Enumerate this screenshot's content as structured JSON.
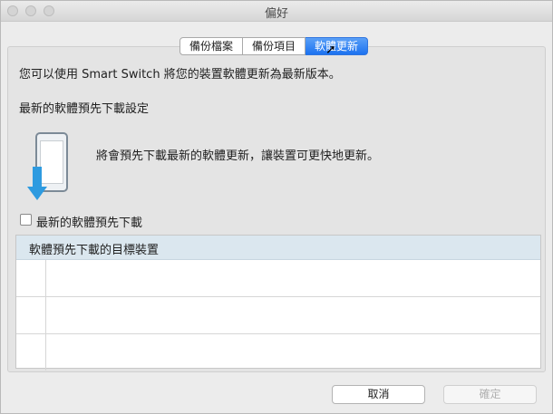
{
  "window": {
    "title": "偏好"
  },
  "tabs": [
    {
      "label": "備份檔案",
      "active": false
    },
    {
      "label": "備份項目",
      "active": false
    },
    {
      "label": "軟體更新",
      "active": true
    }
  ],
  "content": {
    "intro": "您可以使用 Smart Switch 將您的裝置軟體更新為最新版本。",
    "section_title": "最新的軟體預先下載設定",
    "description": "將會預先下載最新的軟體更新，讓裝置可更快地更新。",
    "checkbox_label": "最新的軟體預先下載",
    "checkbox_checked": false,
    "table_header": "軟體預先下載的目標裝置"
  },
  "buttons": {
    "cancel": "取消",
    "confirm": "確定"
  },
  "colors": {
    "accent": "#1c72f0",
    "arrow": "#2e9be0",
    "table_header_bg": "#dbe7ef"
  }
}
